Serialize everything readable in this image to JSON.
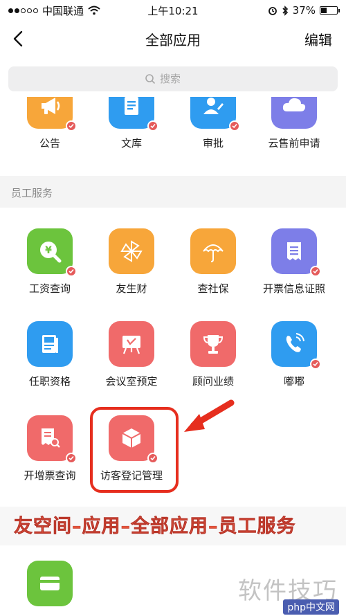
{
  "status_bar": {
    "carrier": "中国联通",
    "time": "上午10:21",
    "battery": "37%",
    "battery_level": 0.37
  },
  "nav": {
    "title": "全部应用",
    "edit": "编辑"
  },
  "search": {
    "placeholder": "搜索"
  },
  "top_apps": [
    {
      "label": "公告",
      "color": "#f7a63a",
      "icon": "megaphone-icon"
    },
    {
      "label": "文库",
      "color": "#2f9cf0",
      "icon": "document-icon"
    },
    {
      "label": "审批",
      "color": "#2f9cf0",
      "icon": "approval-user-icon"
    },
    {
      "label": "云售前申请",
      "color": "#7d7ee8",
      "icon": "cloud-icon"
    }
  ],
  "section": {
    "title": "员工服务"
  },
  "staff_apps": [
    {
      "label": "工资查询",
      "color": "#6cc43d",
      "icon": "salary-search-icon"
    },
    {
      "label": "友生财",
      "color": "#f7a63a",
      "icon": "pinwheel-icon"
    },
    {
      "label": "查社保",
      "color": "#f7a63a",
      "icon": "umbrella-icon"
    },
    {
      "label": "开票信息证照",
      "color": "#7d7ee8",
      "icon": "receipt-icon"
    },
    {
      "label": "任职资格",
      "color": "#2f9cf0",
      "icon": "certificate-icon"
    },
    {
      "label": "会议室预定",
      "color": "#f06a6a",
      "icon": "meeting-board-icon"
    },
    {
      "label": "顾问业绩",
      "color": "#f06a6a",
      "icon": "trophy-icon"
    },
    {
      "label": "嘟嘟",
      "color": "#2f9cf0",
      "icon": "phone-icon"
    },
    {
      "label": "开增票查询",
      "color": "#f06a6a",
      "icon": "invoice-search-icon"
    },
    {
      "label": "访客登记管理",
      "color": "#f06a6a",
      "icon": "box-icon"
    }
  ],
  "bottom_apps": [
    {
      "color": "#6cc43d",
      "icon": "card-icon"
    }
  ],
  "annotation": {
    "caption": "友空间–应用–全部应用–员工服务"
  },
  "watermark": {
    "main": "软件技巧",
    "badge": "php中文网"
  }
}
